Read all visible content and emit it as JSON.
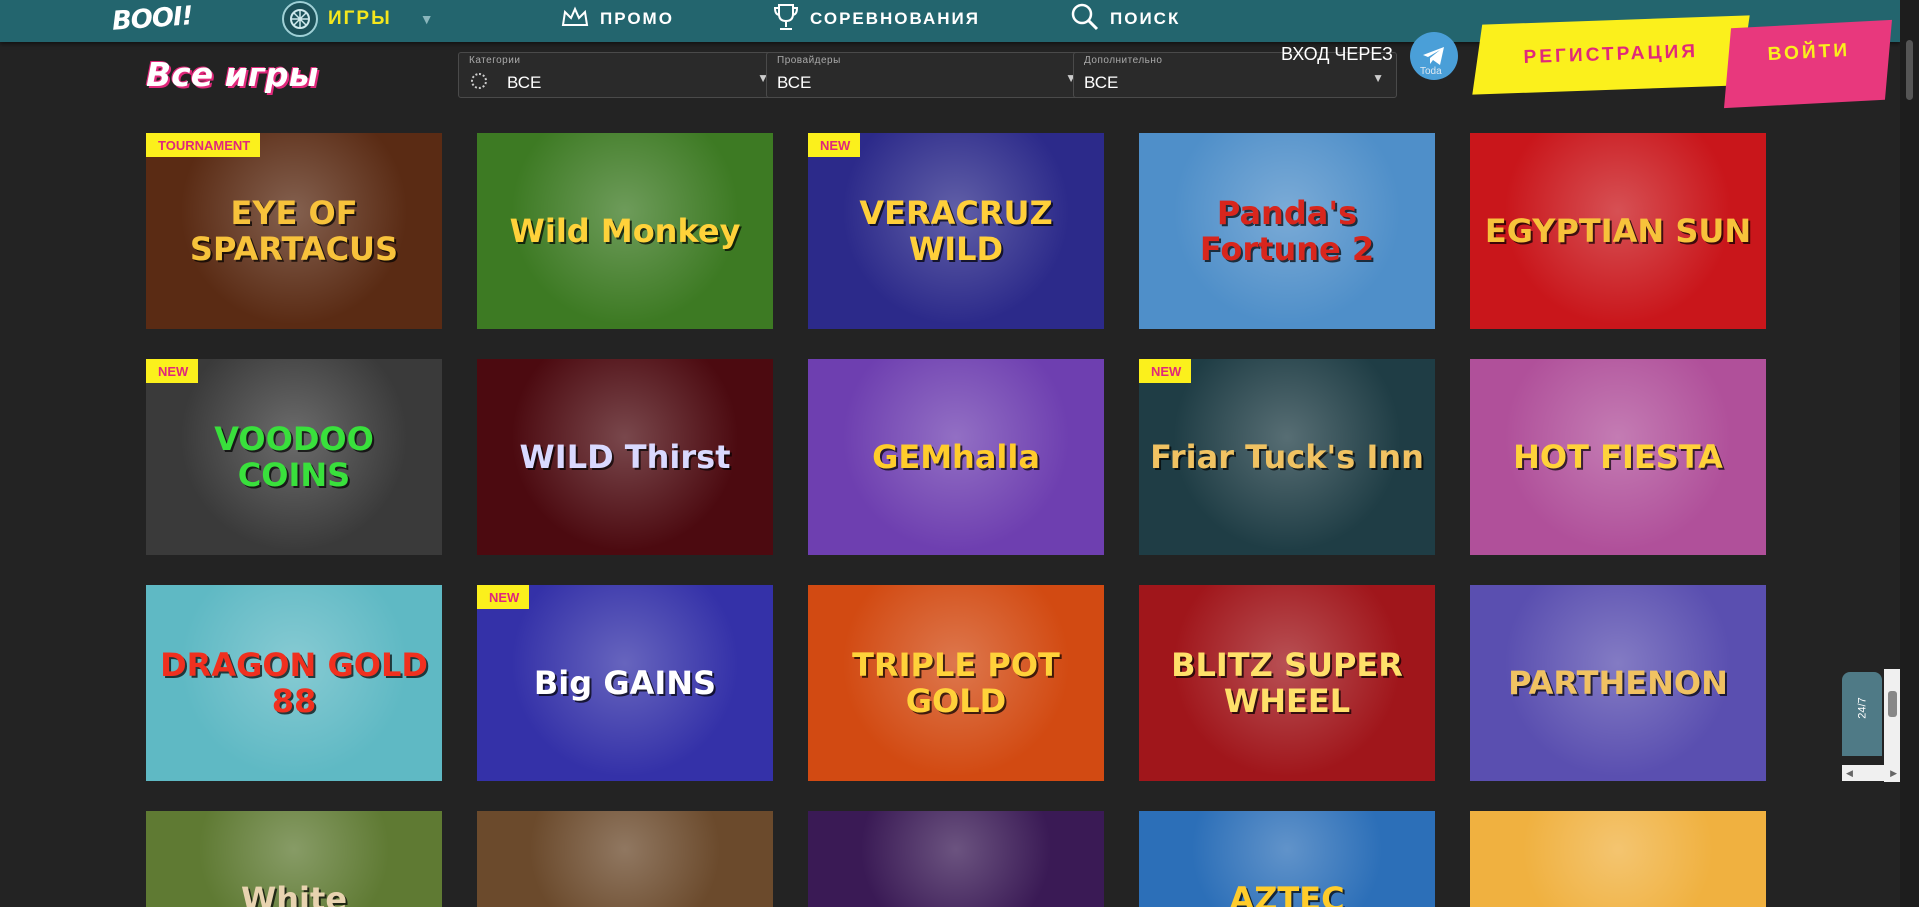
{
  "nav": {
    "logo": "BOOI!",
    "items": [
      {
        "label": "ИГРЫ",
        "icon": "games-wheel-icon",
        "active": true
      },
      {
        "label": "ПРОМО",
        "icon": "crown-icon"
      },
      {
        "label": "СОРЕВНОВАНИЯ",
        "icon": "trophy-icon"
      },
      {
        "label": "ПОИСК",
        "icon": "search-icon"
      }
    ]
  },
  "page": {
    "title": "Все игры"
  },
  "filters": [
    {
      "label": "Категории",
      "value": "ВСЕ",
      "icon": "category-icon"
    },
    {
      "label": "Провайдеры",
      "value": "ВСЕ"
    },
    {
      "label": "Дополнительно",
      "value": "ВСЕ"
    }
  ],
  "auth": {
    "login_via": "ВХОД ЧЕРЕЗ",
    "telegram_caption": "Toda",
    "register": "РЕГИСТРАЦИЯ",
    "login": "ВОЙТИ"
  },
  "games": [
    {
      "title": "EYE OF SPARTACUS",
      "badge": "TOURNAMENT",
      "bg": "#5a2b14",
      "fg": "#f7c23b"
    },
    {
      "title": "Wild Monkey",
      "badge": "",
      "bg": "#3d7a23",
      "fg": "#ffd23a"
    },
    {
      "title": "VERACRUZ WILD",
      "badge": "NEW",
      "bg": "#2c2a8a",
      "fg": "#ffcf3a"
    },
    {
      "title": "Panda's Fortune 2",
      "badge": "",
      "bg": "#4f8fc9",
      "fg": "#d8261d"
    },
    {
      "title": "EGYPTIAN SUN",
      "badge": "",
      "bg": "#c9161b",
      "fg": "#f7c23b"
    },
    {
      "title": "VOODOO COINS",
      "badge": "NEW",
      "bg": "#3a3a3a",
      "fg": "#39e03c"
    },
    {
      "title": "WILD Thirst",
      "badge": "",
      "bg": "#4c0a10",
      "fg": "#d9d9ff"
    },
    {
      "title": "GEMhalla",
      "badge": "",
      "bg": "#6e3fb0",
      "fg": "#ffcc2b"
    },
    {
      "title": "Friar Tuck's Inn",
      "badge": "NEW",
      "bg": "#1f3d45",
      "fg": "#f0c262"
    },
    {
      "title": "HOT FIESTA",
      "badge": "",
      "bg": "#b0509a",
      "fg": "#ffd23a"
    },
    {
      "title": "DRAGON GOLD 88",
      "badge": "",
      "bg": "#5fb9c4",
      "fg": "#f0301f"
    },
    {
      "title": "Big GAINS",
      "badge": "NEW",
      "bg": "#3431a8",
      "fg": "#ffffff"
    },
    {
      "title": "TRIPLE POT GOLD",
      "badge": "",
      "bg": "#d24a12",
      "fg": "#ffd23a"
    },
    {
      "title": "BLITZ SUPER WHEEL",
      "badge": "",
      "bg": "#a0161b",
      "fg": "#ffe06a"
    },
    {
      "title": "PARTHENON",
      "badge": "",
      "bg": "#5a4fb0",
      "fg": "#f0c262"
    },
    {
      "title": "White",
      "badge": "",
      "bg": "#5f7a33",
      "fg": "#e8d3b0"
    },
    {
      "title": "",
      "badge": "",
      "bg": "#6b4a2c",
      "fg": "#ffffff"
    },
    {
      "title": "",
      "badge": "",
      "bg": "#3a1a55",
      "fg": "#ffffff"
    },
    {
      "title": "AZTEC",
      "badge": "",
      "bg": "#2c6fb8",
      "fg": "#ffcc2b"
    },
    {
      "title": "",
      "badge": "",
      "bg": "#f0b140",
      "fg": "#ffffff"
    }
  ],
  "chat": {
    "label": "24/7"
  }
}
